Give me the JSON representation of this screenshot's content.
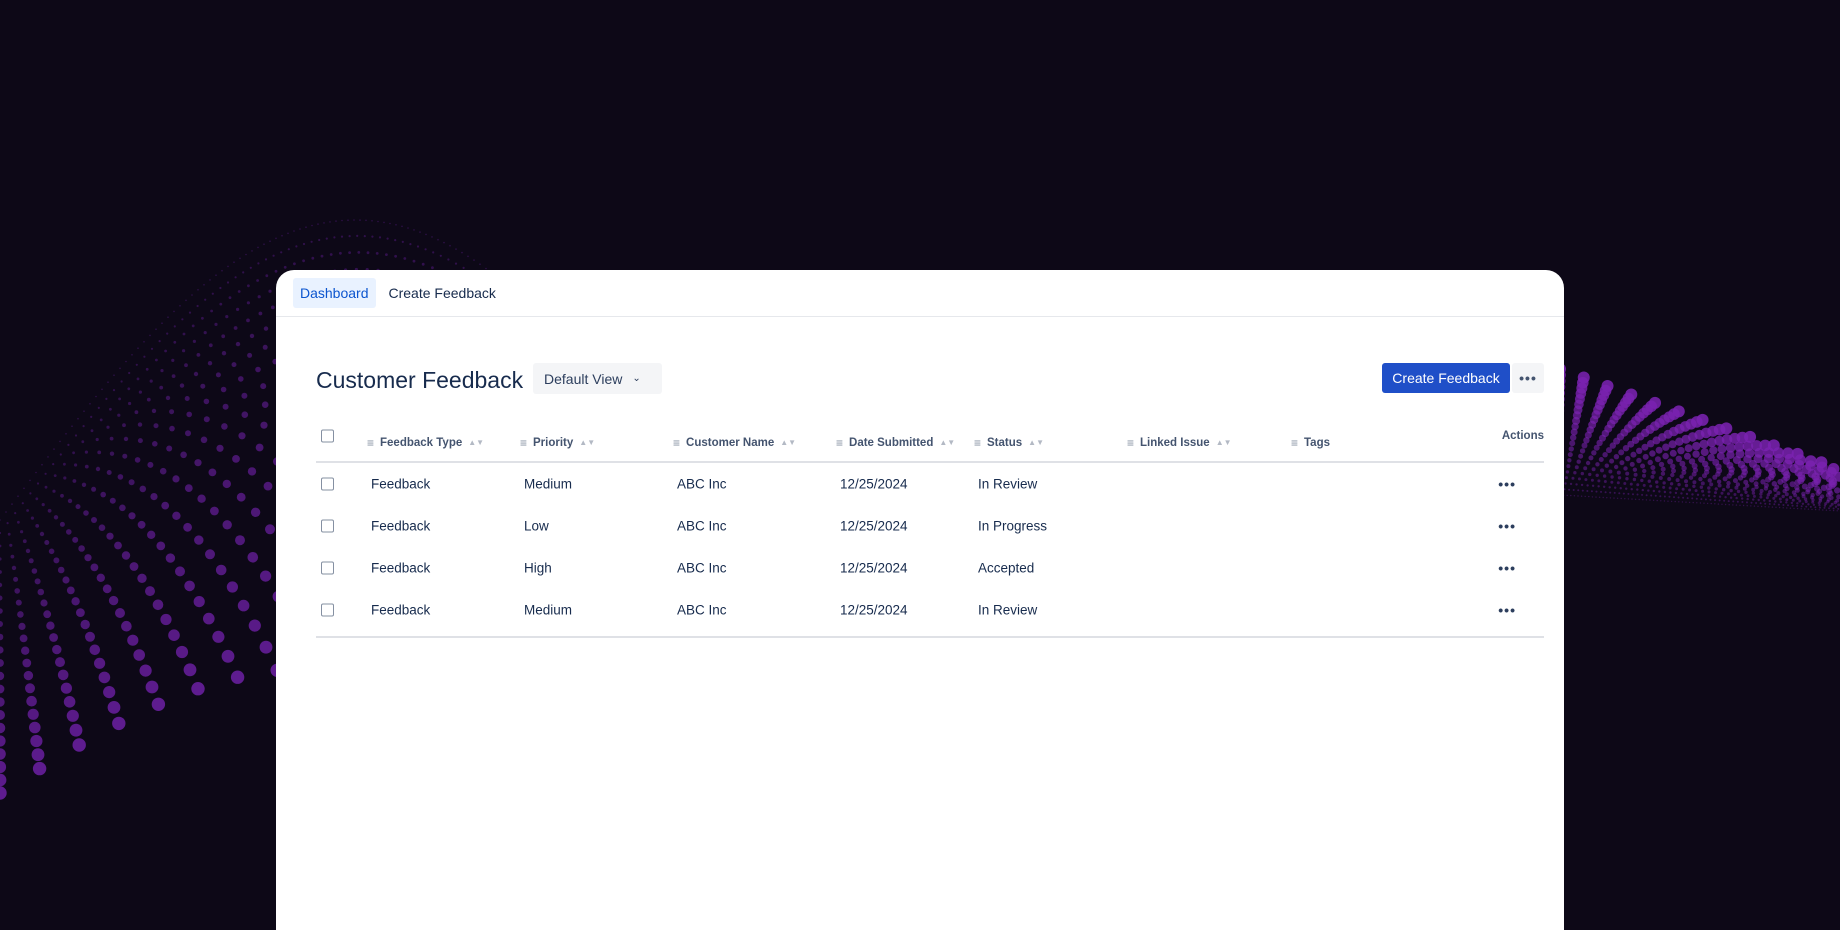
{
  "nav": {
    "tabs": [
      {
        "label": "Dashboard",
        "active": true
      },
      {
        "label": "Create Feedback",
        "active": false
      }
    ]
  },
  "header": {
    "title": "Customer Feedback",
    "view_select": "Default View",
    "create_button": "Create Feedback",
    "more_icon": "more-horizontal-icon"
  },
  "table": {
    "columns": [
      "Feedback Type",
      "Priority",
      "Customer Name",
      "Date Submitted",
      "Status",
      "Linked Issue",
      "Tags",
      "Actions"
    ],
    "rows": [
      {
        "type": "Feedback",
        "priority": "Medium",
        "customer": "ABC Inc",
        "date": "12/25/2024",
        "status": "In Review",
        "linked": "",
        "tags": ""
      },
      {
        "type": "Feedback",
        "priority": "Low",
        "customer": "ABC Inc",
        "date": "12/25/2024",
        "status": "In Progress",
        "linked": "",
        "tags": ""
      },
      {
        "type": "Feedback",
        "priority": "High",
        "customer": "ABC Inc",
        "date": "12/25/2024",
        "status": "Accepted",
        "linked": "",
        "tags": ""
      },
      {
        "type": "Feedback",
        "priority": "Medium",
        "customer": "ABC Inc",
        "date": "12/25/2024",
        "status": "In Review",
        "linked": "",
        "tags": ""
      }
    ]
  },
  "colors": {
    "background": "#0d0817",
    "accent": "#1f4fc8",
    "wave": "#6a1fa0"
  }
}
